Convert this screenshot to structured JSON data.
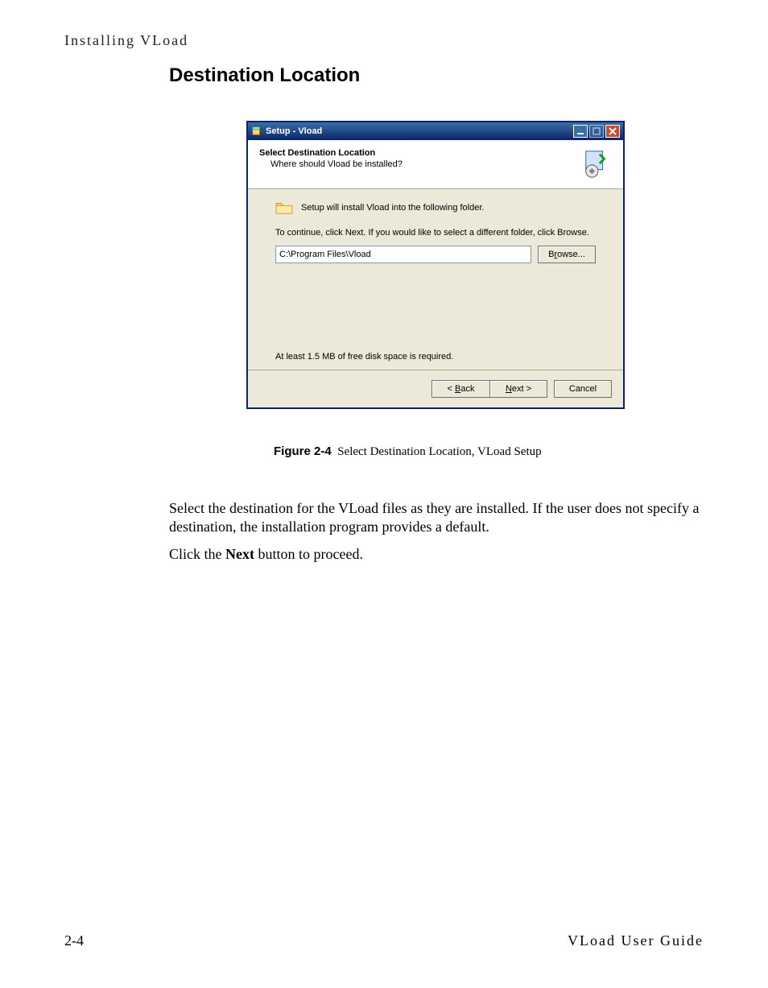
{
  "page": {
    "header": "Installing VLoad",
    "section_title": "Destination Location",
    "page_number": "2-4",
    "footer_right": "VLoad User Guide"
  },
  "figure": {
    "label": "Figure 2-4",
    "caption": "Select Destination Location, VLoad Setup"
  },
  "body": {
    "p1": "Select the destination for the VLoad files as they are installed. If the user does not specify a destination, the installation program provides a default.",
    "p2_a": "Click the ",
    "p2_bold": "Next",
    "p2_b": " button to proceed."
  },
  "dialog": {
    "title": "Setup - Vload",
    "header_title": "Select Destination Location",
    "header_sub": "Where should Vload be installed?",
    "install_line": "Setup will install Vload into the following folder.",
    "continue_line": "To continue, click Next. If you would like to select a different folder, click Browse.",
    "path_value": "C:\\Program Files\\Vload",
    "browse_pre": "B",
    "browse_mid": "r",
    "browse_post": "owse...",
    "space_required": "At least 1.5 MB of free disk space is required.",
    "back_pre": "< ",
    "back_mid": "B",
    "back_post": "ack",
    "next_mid": "N",
    "next_post": "ext >",
    "cancel": "Cancel"
  }
}
